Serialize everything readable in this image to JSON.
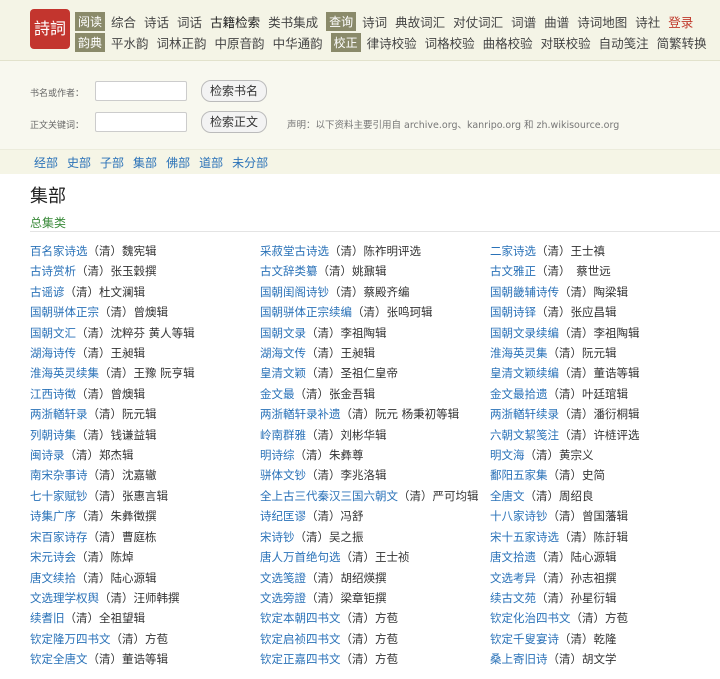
{
  "logo": {
    "text": "詩詞"
  },
  "nav": {
    "row1": [
      {
        "label": "阅读",
        "tag": true
      },
      {
        "label": "综合"
      },
      {
        "label": "诗话"
      },
      {
        "label": "词话"
      },
      {
        "label": "古籍检索",
        "active": true
      },
      {
        "label": "类书集成"
      },
      {
        "label": "查询",
        "tag": true
      },
      {
        "label": "诗词"
      },
      {
        "label": "典故词汇"
      },
      {
        "label": "对仗词汇"
      },
      {
        "label": "词谱"
      },
      {
        "label": "曲谱"
      },
      {
        "label": "诗词地图"
      },
      {
        "label": "诗社"
      },
      {
        "label": "登录",
        "login": true
      }
    ],
    "row2": [
      {
        "label": "韵典",
        "tag": true
      },
      {
        "label": "平水韵"
      },
      {
        "label": "词林正韵"
      },
      {
        "label": "中原音韵"
      },
      {
        "label": "中华通韵"
      },
      {
        "label": "校正",
        "tag": true
      },
      {
        "label": "律诗校验"
      },
      {
        "label": "词格校验"
      },
      {
        "label": "曲格校验"
      },
      {
        "label": "对联校验"
      },
      {
        "label": "自动笺注"
      },
      {
        "label": "简繁转换"
      }
    ]
  },
  "search": {
    "book_label": "书名或作者：",
    "text_label": "正文关键词：",
    "book_button": "检索书名",
    "text_button": "检索正文",
    "notice": "声明：以下资料主要引用自 archive.org、kanripo.org 和 zh.wikisource.org"
  },
  "categories": [
    "经部",
    "史部",
    "子部",
    "集部",
    "佛部",
    "道部",
    "未分部"
  ],
  "page_title": "集部",
  "section_title": "总集类",
  "books": [
    [
      {
        "t": "百名家诗选",
        "a": "（清）魏宪辑"
      },
      {
        "t": "采菽堂古诗选",
        "a": "（清）陈祚明评选"
      },
      {
        "t": "二家诗选",
        "a": "（清）王士禛"
      }
    ],
    [
      {
        "t": "古诗赏析",
        "a": "（清）张玉穀撰"
      },
      {
        "t": "古文辞类纂",
        "a": "（清）姚鼐辑"
      },
      {
        "t": "古文雅正",
        "a": "（清）　蔡世远"
      }
    ],
    [
      {
        "t": "古谣谚",
        "a": "（清）杜文澜辑"
      },
      {
        "t": "国朝闺阁诗钞",
        "a": "（清）蔡殿齐编"
      },
      {
        "t": "国朝畿辅诗传",
        "a": "（清）陶梁辑"
      }
    ],
    [
      {
        "t": "国朝骈体正宗",
        "a": "（清）曾燠辑"
      },
      {
        "t": "国朝骈体正宗续编",
        "a": "（清）张鸣珂辑"
      },
      {
        "t": "国朝诗铎",
        "a": "（清）张应昌辑"
      }
    ],
    [
      {
        "t": "国朝文汇",
        "a": "（清）沈粹芬 黄人等辑"
      },
      {
        "t": "国朝文录",
        "a": "（清）李祖陶辑"
      },
      {
        "t": "国朝文录续编",
        "a": "（清）李祖陶辑"
      }
    ],
    [
      {
        "t": "湖海诗传",
        "a": "（清）王昶辑"
      },
      {
        "t": "湖海文传",
        "a": "（清）王昶辑"
      },
      {
        "t": "淮海英灵集",
        "a": "（清）阮元辑"
      }
    ],
    [
      {
        "t": "淮海英灵续集",
        "a": "（清）王豫 阮亨辑"
      },
      {
        "t": "皇清文颖",
        "a": "（清）圣祖仁皇帝"
      },
      {
        "t": "皇清文颖续编",
        "a": "（清）董诰等辑"
      }
    ],
    [
      {
        "t": "江西诗徵",
        "a": "（清）曾燠辑"
      },
      {
        "t": "金文最",
        "a": "（清）张金吾辑"
      },
      {
        "t": "金文最拾遗",
        "a": "（清）叶廷琯辑"
      }
    ],
    [
      {
        "t": "两浙輶轩录",
        "a": "（清）阮元辑"
      },
      {
        "t": "两浙輶轩录补遗",
        "a": "（清）阮元 杨秉初等辑"
      },
      {
        "t": "两浙輶轩续录",
        "a": "（清）潘衍桐辑"
      }
    ],
    [
      {
        "t": "列朝诗集",
        "a": "（清）钱谦益辑"
      },
      {
        "t": "岭南群雅",
        "a": "（清）刘彬华辑"
      },
      {
        "t": "六朝文絜笺注",
        "a": "（清）许梿评选"
      }
    ],
    [
      {
        "t": "闽诗录",
        "a": "（清）郑杰辑"
      },
      {
        "t": "明诗综",
        "a": "（清）朱彝尊"
      },
      {
        "t": "明文海",
        "a": "（清）黄宗义"
      }
    ],
    [
      {
        "t": "南宋杂事诗",
        "a": "（清）沈嘉辙"
      },
      {
        "t": "骈体文钞",
        "a": "（清）李兆洛辑"
      },
      {
        "t": "鄱阳五家集",
        "a": "（清）史简"
      }
    ],
    [
      {
        "t": "七十家赋钞",
        "a": "（清）张惠言辑"
      },
      {
        "t": "全上古三代秦汉三国六朝文",
        "a": "（清）严可均辑"
      },
      {
        "t": "全唐文",
        "a": "（清）周绍良"
      }
    ],
    [
      {
        "t": "诗集广序",
        "a": "（清）朱彝徵撰"
      },
      {
        "t": "诗纪匡谬",
        "a": "（清）冯舒"
      },
      {
        "t": "十八家诗钞",
        "a": "（清）曾国藩辑"
      }
    ],
    [
      {
        "t": "宋百家诗存",
        "a": "（清）曹庭栋"
      },
      {
        "t": "宋诗钞",
        "a": "（清）吴之振"
      },
      {
        "t": "宋十五家诗选",
        "a": "（清）陈訏辑"
      }
    ],
    [
      {
        "t": "宋元诗会",
        "a": "（清）陈焯"
      },
      {
        "t": "唐人万首绝句选",
        "a": "（清）王士祯"
      },
      {
        "t": "唐文拾遗",
        "a": "（清）陆心源辑"
      }
    ],
    [
      {
        "t": "唐文续拾",
        "a": "（清）陆心源辑"
      },
      {
        "t": "文选笺證",
        "a": "（清）胡绍煐撰"
      },
      {
        "t": "文选考异",
        "a": "（清）孙志祖撰"
      }
    ],
    [
      {
        "t": "文选理学权舆",
        "a": "（清）汪师韩撰"
      },
      {
        "t": "文选旁證",
        "a": "（清）梁章钜撰"
      },
      {
        "t": "续古文苑",
        "a": "（清）孙星衍辑"
      }
    ],
    [
      {
        "t": "续耆旧",
        "a": "（清）全祖望辑"
      },
      {
        "t": "钦定本朝四书文",
        "a": "（清）方苞"
      },
      {
        "t": "钦定化治四书文",
        "a": "（清）方苞"
      }
    ],
    [
      {
        "t": "钦定隆万四书文",
        "a": "（清）方苞"
      },
      {
        "t": "钦定启祯四书文",
        "a": "（清）方苞"
      },
      {
        "t": "钦定千叟宴诗",
        "a": "（清）乾隆"
      }
    ],
    [
      {
        "t": "钦定全唐文",
        "a": "（清）董诰等辑"
      },
      {
        "t": "钦定正嘉四书文",
        "a": "（清）方苞"
      },
      {
        "t": "桑上寄旧诗",
        "a": "（清）胡文学"
      }
    ]
  ]
}
